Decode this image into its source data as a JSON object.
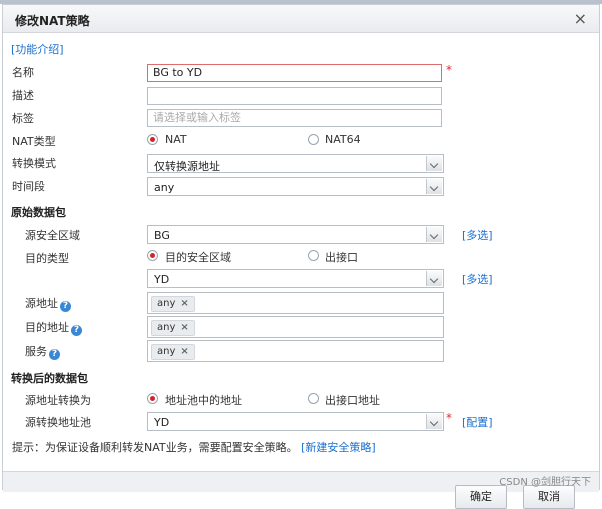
{
  "dialog": {
    "title": "修改NAT策略",
    "close": "×"
  },
  "intro_link": "[功能介绍]",
  "fields": {
    "name_label": "名称",
    "name_value": "BG to YD",
    "required_mark": "*",
    "desc_label": "描述",
    "desc_value": "",
    "tag_label": "标签",
    "tag_placeholder": "请选择或输入标签",
    "nat_type_label": "NAT类型",
    "nat_type_options": [
      "NAT",
      "NAT64"
    ],
    "nat_type_selected": "NAT",
    "convert_mode_label": "转换模式",
    "convert_mode_value": "仅转换源地址",
    "time_label": "时间段",
    "time_value": "any"
  },
  "original_packet": {
    "section_title": "原始数据包",
    "src_zone_label": "源安全区域",
    "src_zone_value": "BG",
    "multi_select": "[多选]",
    "dst_type_label": "目的类型",
    "dst_type_options": [
      "目的安全区域",
      "出接口"
    ],
    "dst_type_selected": "目的安全区域",
    "dst_zone_value": "YD",
    "src_addr_label": "源地址",
    "src_addr_tag": "any",
    "dst_addr_label": "目的地址",
    "dst_addr_tag": "any",
    "service_label": "服务",
    "service_tag": "any",
    "help": "?",
    "tag_remove": "×"
  },
  "converted_packet": {
    "section_title": "转换后的数据包",
    "src_convert_label": "源地址转换为",
    "src_convert_options": [
      "地址池中的地址",
      "出接口地址"
    ],
    "src_convert_selected": "地址池中的地址",
    "pool_label": "源转换地址池",
    "pool_value": "YD",
    "config_link": "[配置]"
  },
  "tip": {
    "text": "提示：为保证设备顺利转发NAT业务，需要配置安全策略。",
    "link": "[新建安全策略]"
  },
  "footer": {
    "ok": "确定",
    "cancel": "取消",
    "watermark": "CSDN @剑胆行天下"
  },
  "colors": {
    "link": "#1a6fcf",
    "required": "#e0282d",
    "radio_on": "#d0232e"
  }
}
